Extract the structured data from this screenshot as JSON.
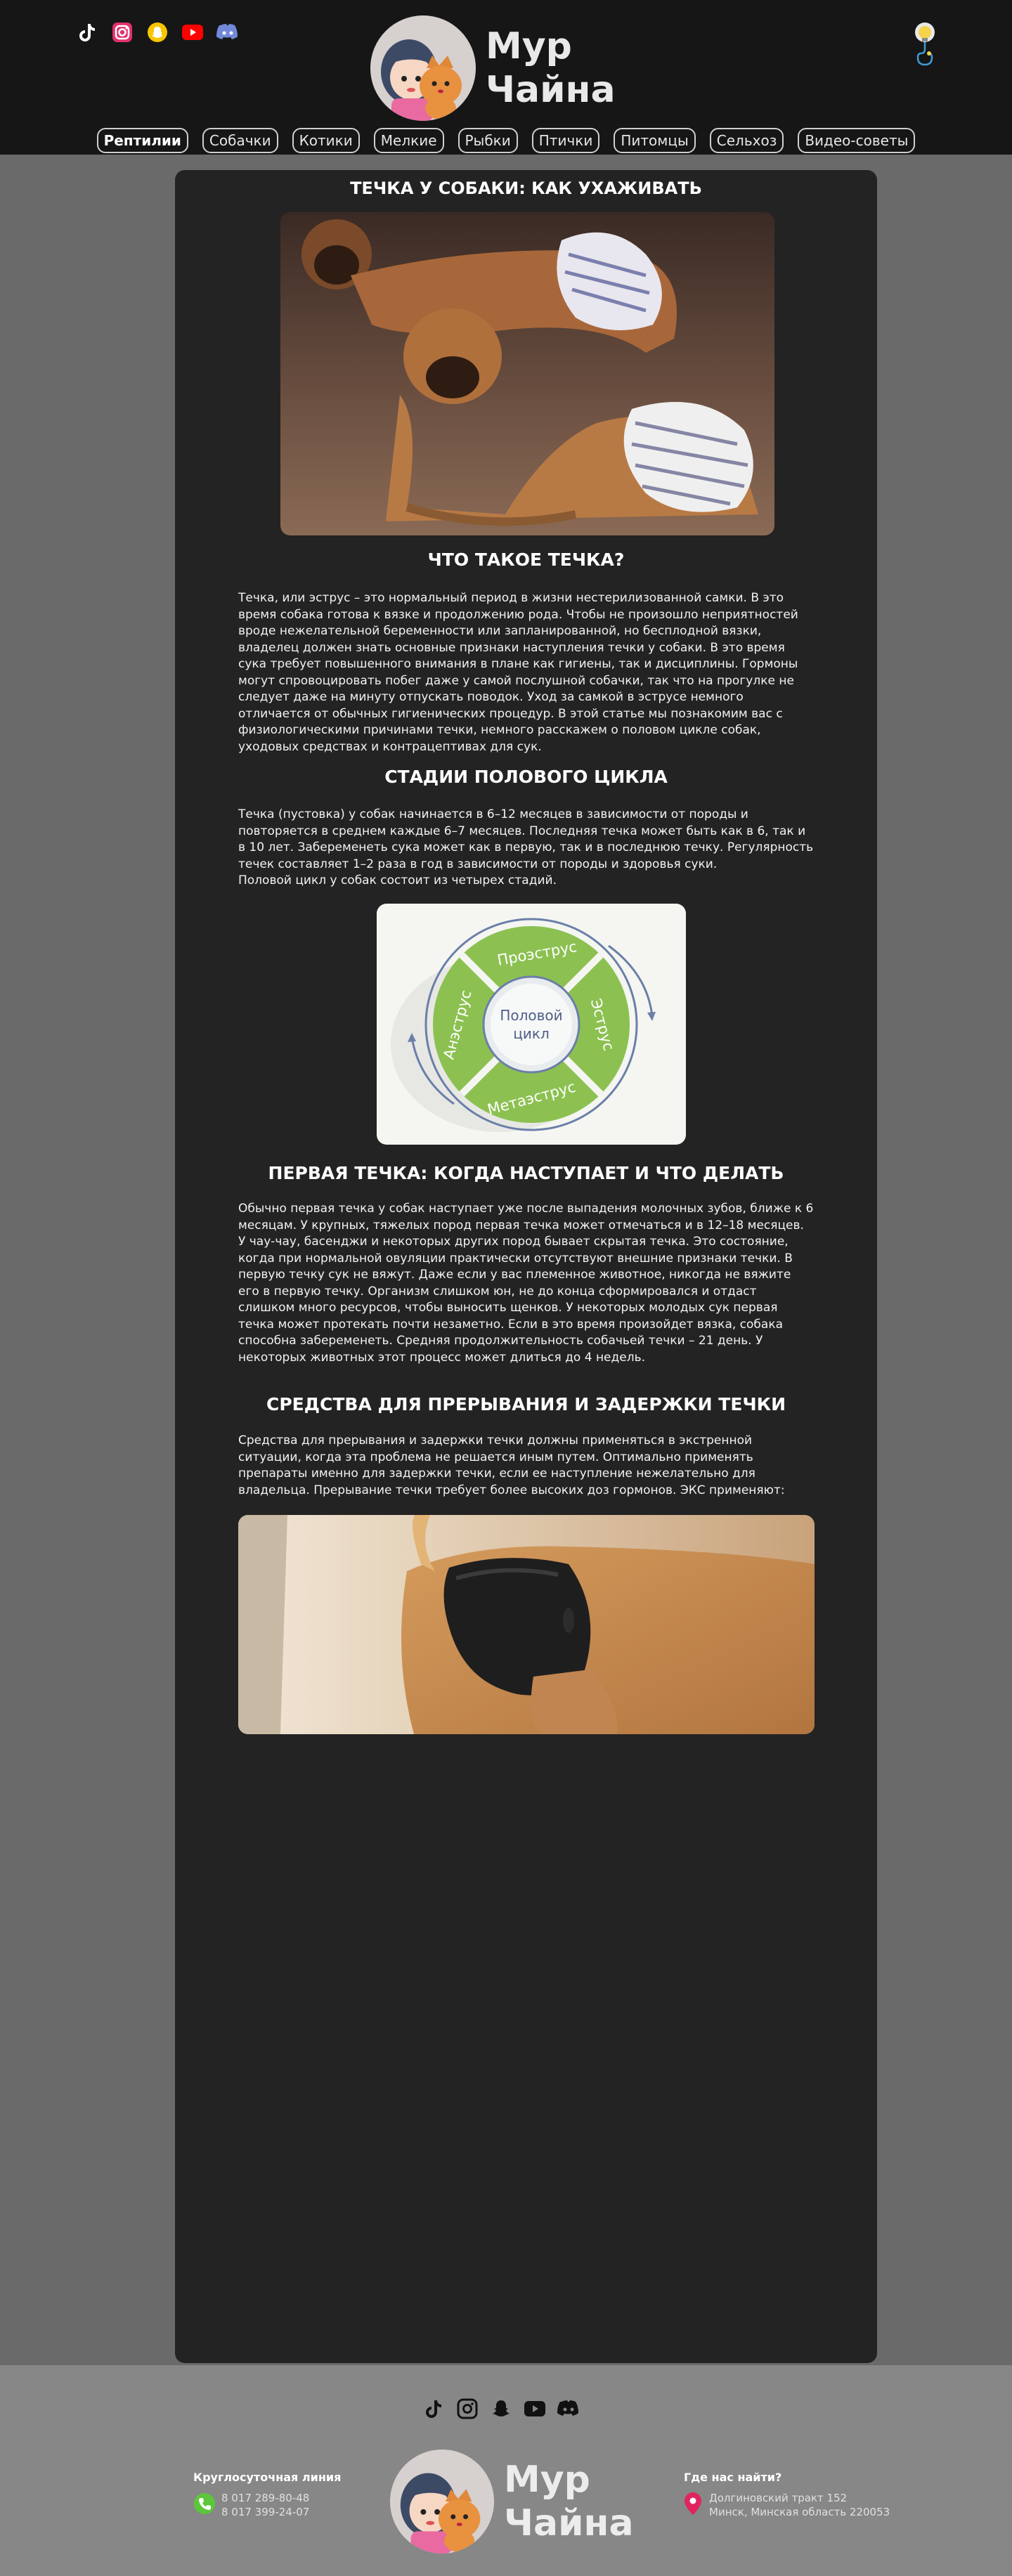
{
  "header": {
    "logo_line1": "Мур",
    "logo_line2": "Чайна",
    "social_icons": [
      "tiktok-icon",
      "instagram-icon",
      "snapchat-icon",
      "youtube-icon",
      "discord-icon"
    ],
    "theme_toggle_icon": "lightbulb-icon"
  },
  "nav": {
    "items": [
      "Рептилии",
      "Собачки",
      "Котики",
      "Мелкие",
      "Рыбки",
      "Птички",
      "Питомцы",
      "Сельхоз",
      "Видео-советы"
    ],
    "active_index": 0
  },
  "article": {
    "title": "ТЕЧКА У СОБАКИ: КАК УХАЖИВАТЬ",
    "section1_heading": "ЧТО ТАКОЕ ТЕЧКА?",
    "section1_text": "Течка, или эструс – это нормальный период в жизни нестерилизованной самки. В это время собака готова к вязке и продолжению рода. Чтобы не произошло неприятностей вроде нежелательной беременности или запланированной, но бесплодной вязки, владелец должен знать основные признаки наступления течки у собаки. В это время сука требует повышенного внимания в плане как гигиены, так и дисциплины. Гормоны могут спровоцировать побег даже у самой послушной собачки, так что на прогулке не следует даже на минуту отпускать поводок. Уход за самкой в эструсе немного отличается от обычных гигиенических процедур. В этой статье мы познакомим вас с физиологическими причинами течки, немного расскажем о половом цикле собак, уходовых средствах и контрацептивах для сук.",
    "section2_heading": "СТАДИИ ПОЛОВОГО ЦИКЛА",
    "section2_text": "Течка (пустовка) у собак начинается в 6–12 месяцев в зависимости от породы и повторяется в среднем каждые 6–7 месяцев. Последняя течка может быть как в 6, так и в 10 лет. Забеременеть сука может как в первую, так и в последнюю течку. Регулярность течек составляет 1–2 раза в год в зависимости от породы и здоровья суки.",
    "section2_text2": "Половой цикл у собак состоит из четырех стадий.",
    "cycle": {
      "center_line1": "Половой",
      "center_line2": "цикл",
      "stage_top": "Проэструс",
      "stage_right": "Эструс",
      "stage_bottom": "Метаэструс",
      "stage_left": "Анэструс"
    },
    "section3_heading": "ПЕРВАЯ ТЕЧКА: КОГДА НАСТУПАЕТ И ЧТО ДЕЛАТЬ",
    "section3_text": "Обычно первая течка у собак наступает уже после выпадения молочных зубов, ближе к 6 месяцам. У крупных, тяжелых пород первая течка может отмечаться и в 12–18 месяцев. У чау-чау, басенджи и некоторых других пород бывает скрытая течка. Это состояние, когда при нормальной овуляции практически отсутствуют внешние признаки течки. В первую течку сук не вяжут. Даже если у вас племенное животное, никогда не вяжите его в первую течку. Организм слишком юн, не до конца сформировался и отдаст слишком много ресурсов, чтобы выносить щенков. У некоторых молодых сук первая течка может протекать почти незаметно. Если в это время произойдет вязка, собака способна забеременеть. Средняя продолжительность собачьей течки – 21 день. У некоторых животных этот процесс может длиться до 4 недель.",
    "section4_heading": "СРЕДСТВА ДЛЯ ПРЕРЫВАНИЯ И ЗАДЕРЖКИ ТЕЧКИ",
    "section4_text": "Средства для прерывания и задержки течки должны применяться в экстренной ситуации, когда эта проблема не решается иным путем. Оптимально применять препараты именно для задержки течки, если ее наступление нежелательно для владельца. Прерывание течки требует более высоких доз гормонов. ЭКС применяют:"
  },
  "footer": {
    "hotline_label": "Круглосуточная линия",
    "phone1": "8 017 289-80-48",
    "phone2": "8 017 399-24-07",
    "logo_line1": "Мур",
    "logo_line2": "Чайна",
    "address_label": "Где нас найти?",
    "address_line1": "Долгиновский тракт 152",
    "address_line2": "Минск, Минская область 220053",
    "social_icons": [
      "tiktok-icon",
      "instagram-icon",
      "snapchat-icon",
      "youtube-icon",
      "discord-icon"
    ]
  },
  "colors": {
    "header_bg": "#161616",
    "page_bg": "#6a6a6a",
    "card_bg": "#232323",
    "footer_bg": "#878787",
    "cycle_green": "#8cc152"
  }
}
